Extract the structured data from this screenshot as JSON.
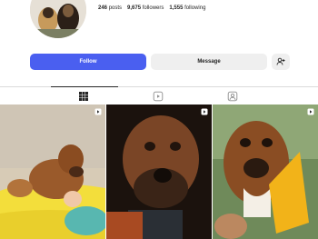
{
  "profile": {
    "stats": {
      "posts_count": "246",
      "posts_label": "posts",
      "followers_count": "9,675",
      "followers_label": "followers",
      "following_count": "1,555",
      "following_label": "following"
    }
  },
  "actions": {
    "follow_label": "Follow",
    "message_label": "Message"
  },
  "colors": {
    "follow_button": "#4a5ff0",
    "secondary_button": "#efefef",
    "text": "#262626",
    "divider": "#dbdbdb"
  },
  "icons": {
    "tabs": [
      "grid-icon",
      "reels-icon",
      "tagged-icon"
    ],
    "suggest": "add-person-icon",
    "post_overlay": "reel-icon"
  }
}
